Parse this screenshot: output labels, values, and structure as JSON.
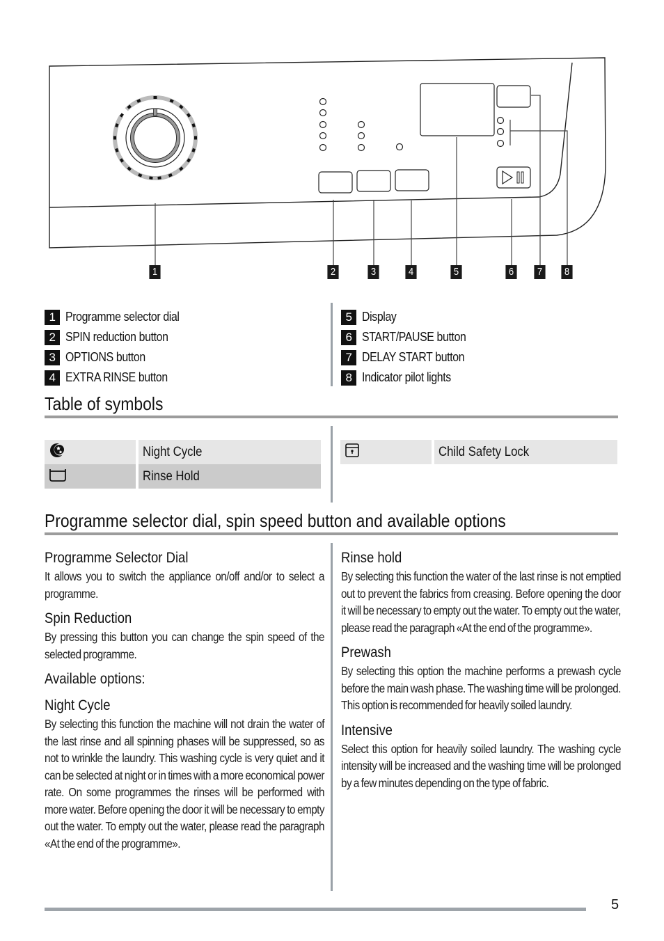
{
  "diagram": {
    "callouts": [
      "1",
      "2",
      "3",
      "4",
      "5",
      "6",
      "7",
      "8"
    ],
    "start_pause_icon": "play-pause-icon"
  },
  "legend": {
    "left": [
      {
        "num": "1",
        "label": "Programme selector dial"
      },
      {
        "num": "2",
        "label": "SPIN reduction button"
      },
      {
        "num": "3",
        "label": "OPTIONS button"
      },
      {
        "num": "4",
        "label": "EXTRA RINSE button"
      }
    ],
    "right": [
      {
        "num": "5",
        "label": "Display"
      },
      {
        "num": "6",
        "label": "START/PAUSE button"
      },
      {
        "num": "7",
        "label": "DELAY START button"
      },
      {
        "num": "8",
        "label": "Indicator pilot lights"
      }
    ]
  },
  "symbols": {
    "title": "Table of symbols",
    "left": [
      {
        "icon": "night-cycle-icon",
        "label": "Night Cycle"
      },
      {
        "icon": "rinse-hold-icon",
        "label": "Rinse Hold"
      }
    ],
    "right": [
      {
        "icon": "child-lock-icon",
        "label": "Child Safety Lock"
      }
    ]
  },
  "section": {
    "title": "Programme selector dial, spin speed button and available options",
    "left": [
      {
        "heading": "Programme Selector Dial",
        "body": "It allows you to switch the appliance on/off and/or to select a programme."
      },
      {
        "heading": "Spin Reduction",
        "body": "By pressing this button you can change the spin speed of the selected programme."
      },
      {
        "heading": "Available options:",
        "body": ""
      },
      {
        "heading": "Night Cycle",
        "body": "By selecting this function the machine will not drain the water of the last rinse and all spinning phases will be suppressed, so as not to wrinkle the laundry. This washing cycle is very quiet and it can be selected at night or in times with a more economical power rate. On some programmes the rinses will be performed with more water. Before opening the door it will be necessary to empty out the water. To empty out the water, please read the paragraph «At the end of the programme»."
      }
    ],
    "right": [
      {
        "heading": "Rinse hold",
        "body": "By selecting this function the water of the last rinse is not emptied out to prevent the fabrics from creasing. Before opening the door it will be necessary to empty out the water. To empty out the water, please read the paragraph «At the end of the programme»."
      },
      {
        "heading": "Prewash",
        "body": "By selecting this option the machine performs a prewash cycle before the main wash phase. The washing time will be prolonged. This option is recommended for heavily soiled laundry."
      },
      {
        "heading": "Intensive",
        "body": "Select this option for heavily soiled laundry. The washing cycle intensity will be increased and the washing time will be prolonged by a few minutes depending on the type of fabric."
      }
    ]
  },
  "page_number": "5"
}
